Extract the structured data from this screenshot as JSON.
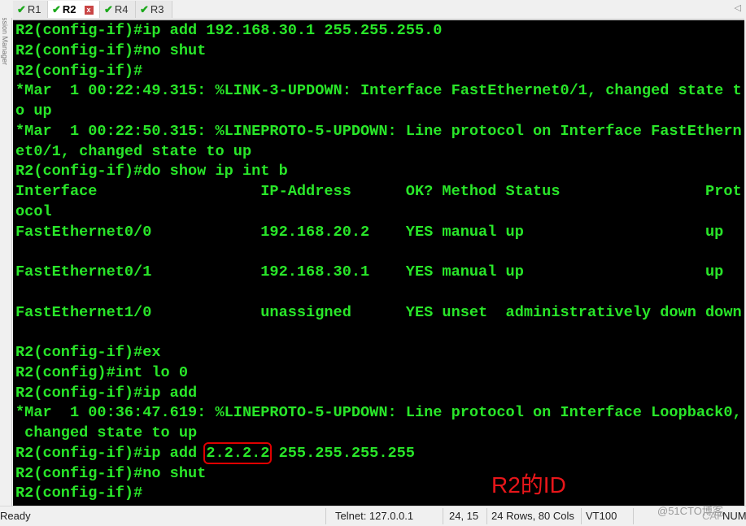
{
  "tabs": [
    {
      "label": "R1",
      "active": false
    },
    {
      "label": "R2",
      "active": true,
      "close": "x"
    },
    {
      "label": "R4",
      "active": false
    },
    {
      "label": "R3",
      "active": false
    }
  ],
  "sidebar": {
    "label": "Session Manager"
  },
  "terminal": {
    "lines": [
      "R2(config-if)#ip add 192.168.30.1 255.255.255.0",
      "R2(config-if)#no shut",
      "R2(config-if)#",
      "*Mar  1 00:22:49.315: %LINK-3-UPDOWN: Interface FastEthernet0/1, changed state t",
      "o up",
      "*Mar  1 00:22:50.315: %LINEPROTO-5-UPDOWN: Line protocol on Interface FastEthern",
      "et0/1, changed state to up",
      "R2(config-if)#do show ip int b",
      "Interface                  IP-Address      OK? Method Status                Prot",
      "ocol",
      "FastEthernet0/0            192.168.20.2    YES manual up                    up",
      "",
      "FastEthernet0/1            192.168.30.1    YES manual up                    up",
      "",
      "FastEthernet1/0            unassigned      YES unset  administratively down down",
      "",
      "R2(config-if)#ex",
      "R2(config)#int lo 0",
      "R2(config-if)#ip add",
      "*Mar  1 00:36:47.619: %LINEPROTO-5-UPDOWN: Line protocol on Interface Loopback0,",
      " changed state to up"
    ],
    "highlight_line": {
      "prefix": "R2(config-if)#ip add ",
      "highlight": "2.2.2.2",
      "suffix": " 255.255.255.255"
    },
    "tail_lines": [
      "R2(config-if)#no shut",
      "R2(config-if)#"
    ],
    "text_color": "#29e629"
  },
  "annotation": {
    "text": "R2的ID",
    "color": "#e8161a"
  },
  "status": {
    "ready": "Ready",
    "connection": "Telnet: 127.0.0.1",
    "cursor": "24, 15",
    "size": "24 Rows, 80 Cols",
    "emulation": "VT100",
    "caps": "CAP",
    "num": "NUM",
    "watermark": "@51CTO博客"
  }
}
